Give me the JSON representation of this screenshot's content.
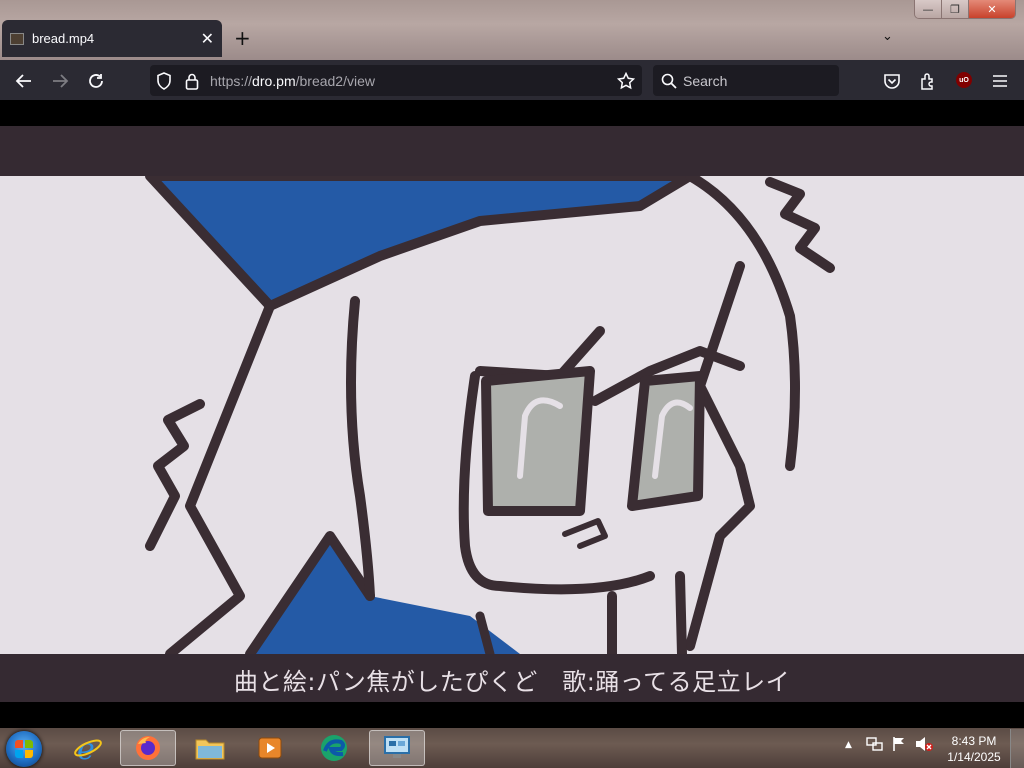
{
  "window": {
    "minimize_glyph": "—",
    "maximize_glyph": "❐",
    "close_glyph": "✕"
  },
  "tab": {
    "title": "bread.mp4",
    "close_glyph": "✕",
    "new_tab_glyph": "+",
    "list_glyph": "⌄"
  },
  "nav": {
    "url_scheme": "https://",
    "url_host": "dro.pm",
    "url_path": "/bread2/view",
    "search_placeholder": "Search",
    "ublock_label": "uO"
  },
  "video": {
    "subtitle": "曲と絵:パン焦がしたぴくど　歌:踊ってる足立レイ"
  },
  "taskbar": {
    "apps": [
      "windows-start",
      "internet-explorer",
      "firefox",
      "file-explorer",
      "media-player",
      "edge",
      "remote-desktop"
    ],
    "active_app": "firefox",
    "tray_expand_glyph": "▲",
    "clock_time": "8:43 PM",
    "clock_date": "1/14/2025"
  },
  "colors": {
    "browser_chrome": "#2b2a33",
    "url_field": "#1c1b22",
    "video_letterbox": "#352a32",
    "video_background": "#e5e0e6",
    "character_blue": "#245aa6",
    "outline": "#3a2d33",
    "eye_gray": "#aeb0ac"
  }
}
